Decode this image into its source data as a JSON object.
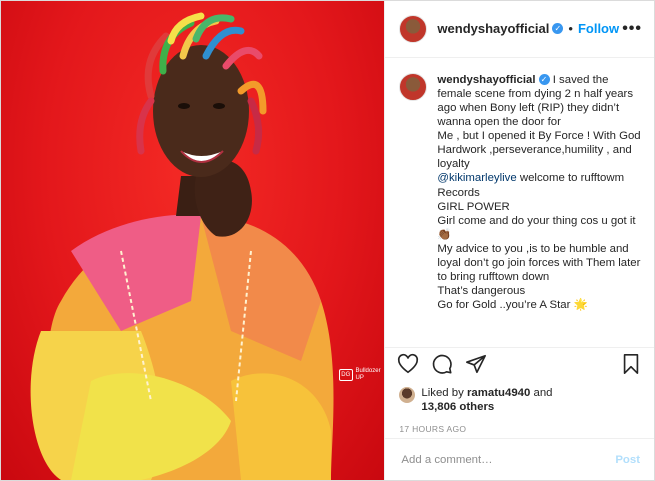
{
  "post": {
    "username": "wendyshayofficial",
    "verified_icon": "verified-badge-icon",
    "separator": "•",
    "follow_label": "Follow",
    "more_label": "•••",
    "caption": "I saved the female scene from dying 2 n half years ago when Bony left (RIP) they didn’t wanna open the door for\nMe , but I opened it By Force ! With God\nHardwork ,perseverance,humility , and loyalty\n",
    "mention": "@kikimarleylive",
    "caption_rest": " welcome to rufftowm Records\nGIRL POWER\nGirl come and do your thing cos u got it 👏🏾\nMy advice to you ,is to be humble and loyal don’t go join forces with Them later to bring rufftown down\nThat’s dangerous\nGo for Gold ..you’re A Star 🌟",
    "liked_by_prefix": "Liked by ",
    "liked_by_user": "ramatu4940",
    "liked_by_and": " and",
    "likes_count": "13,806 others",
    "timestamp": "17 HOURS AGO",
    "comment_placeholder": "Add a comment…",
    "post_label": "Post",
    "watermark": "Bulldozer UP",
    "watermark_mark": "DG"
  },
  "colors": {
    "accent": "#0095f6",
    "post_disabled": "#b2dffc",
    "photo_background": "#e3171b"
  }
}
